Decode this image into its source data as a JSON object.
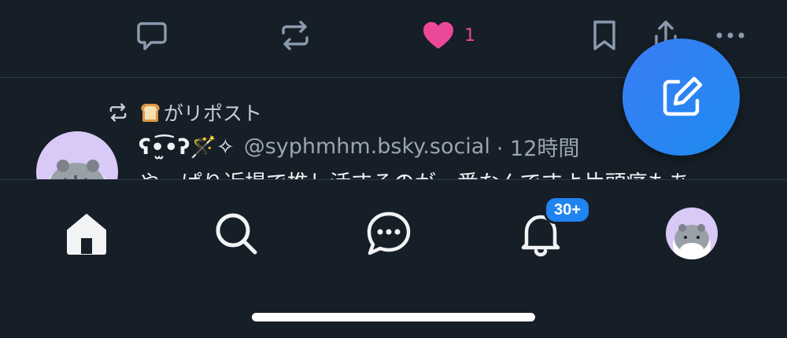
{
  "actions": {
    "like_count": "1"
  },
  "post": {
    "repost_label": "がリポスト",
    "author_name": "ʕ•̫͡•ʔ🪄✧",
    "author_handle": "@syphmhm.bsky.social",
    "time": "· 12時間",
    "text": "やっぱり近場で推し活するのが一番なんですよ片頭痛もあ"
  },
  "tabs": {
    "notifications_badge": "30+"
  },
  "colors": {
    "background": "#161e27",
    "like": "#ec4899",
    "accent": "#1f83f0",
    "icon": "#8a9bb0"
  },
  "icons": [
    "reply-icon",
    "repost-icon",
    "heart-icon",
    "bookmark-icon",
    "share-icon",
    "more-icon",
    "home-icon",
    "search-icon",
    "chat-icon",
    "bell-icon",
    "compose-icon"
  ]
}
